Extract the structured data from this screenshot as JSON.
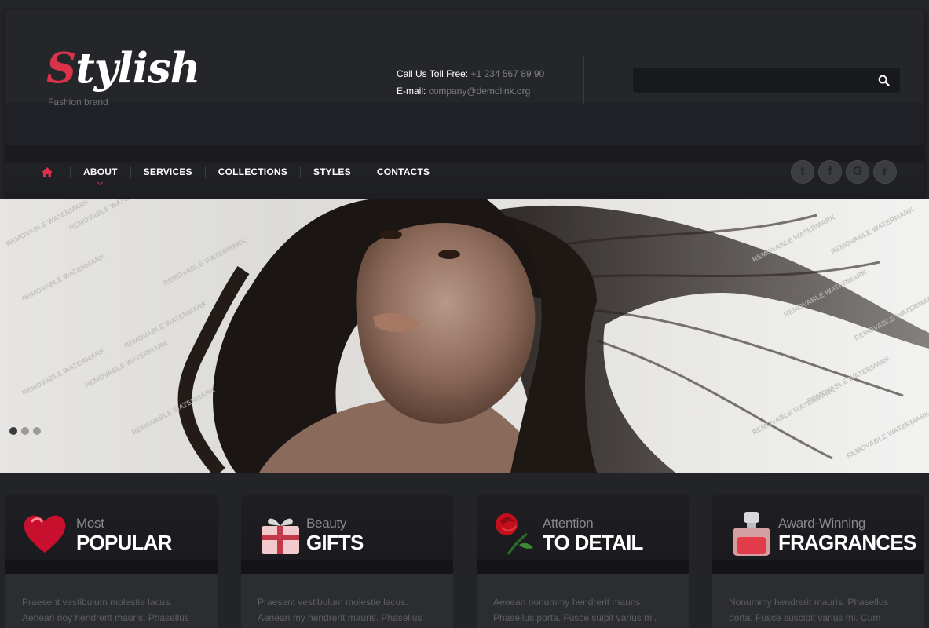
{
  "brand": {
    "logo_first": "S",
    "logo_rest": "tylish",
    "tagline": "Fashion brand"
  },
  "contact": {
    "phone_label": "Call Us Toll Free:",
    "phone_value": "+1 234 567 89 90",
    "email_label": "E-mail:",
    "email_value": "company@demolink.org"
  },
  "search": {
    "placeholder": ""
  },
  "nav": {
    "items": [
      {
        "label": "ABOUT",
        "active": true
      },
      {
        "label": "SERVICES"
      },
      {
        "label": "COLLECTIONS"
      },
      {
        "label": "STYLES"
      },
      {
        "label": "CONTACTS"
      }
    ]
  },
  "social": [
    {
      "name": "twitter-icon",
      "glyph": "t"
    },
    {
      "name": "facebook-icon",
      "glyph": "f"
    },
    {
      "name": "google-icon",
      "glyph": "G"
    },
    {
      "name": "rss-icon",
      "glyph": "r"
    }
  ],
  "slider": {
    "watermark": "REMOVABLE WATERMARK",
    "slide_count": 3,
    "active_slide": 1
  },
  "features": [
    {
      "small": "Most",
      "big": "POPULAR",
      "icon": "heart-icon",
      "text": "Praesent vestibulum molestie lacus. Aenean noy hendrerit mauris. Phasellus"
    },
    {
      "small": "Beauty",
      "big": "GIFTS",
      "icon": "gift-icon",
      "text": "Praesent vestibulum molestie lacus. Aenean my hendrerit mauris. Phasellus"
    },
    {
      "small": "Attention",
      "big": "TO DETAIL",
      "icon": "rose-icon",
      "text": "Aenean nonummy hendrerit mauris. Phasellus porta. Fusce suipit varius mi."
    },
    {
      "small": "Award-Winning",
      "big": "FRAGRANCES",
      "icon": "perfume-icon",
      "text": "Nonummy hendrerit mauris. Phasellus porta. Fusce suscipit varius mi. Cum"
    }
  ],
  "colors": {
    "accent": "#d9324a",
    "background": "#242528"
  }
}
